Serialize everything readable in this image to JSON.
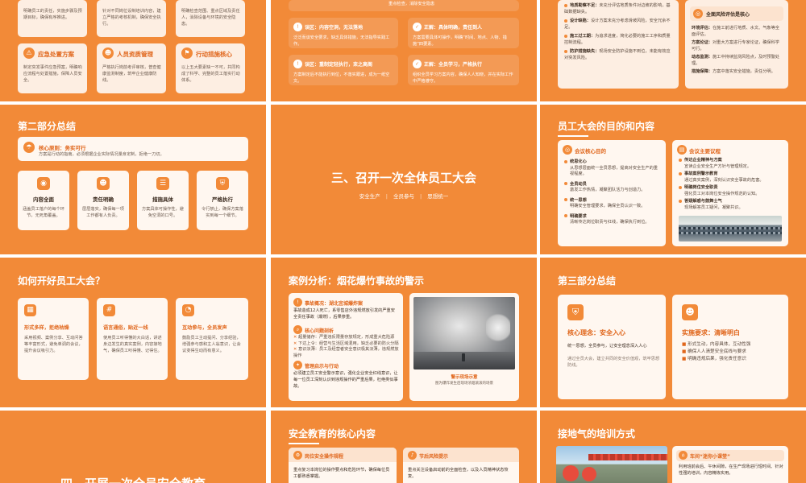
{
  "colors": {
    "accent": "#F28A38",
    "card": "#FDEEE2",
    "title": "#E0661B"
  },
  "r1": {
    "s1": {
      "c1_text": "明确员工的责任，实施步骤及预期目标，确保有序推进。",
      "c2_text": "针对不同岗位设制培训内容，建立严格的考核机制，确保安全执行。",
      "c3_text": "明确检查范围、重点区域及责任人，消除设备与环境的安全隐患。",
      "c4_title": "应急处置方案",
      "c4_text": "制定突发事件应急预案，明确响应流程与处置措施，保障人员安全。",
      "c5_title": "人员资质管理",
      "c5_text": "严格执行岗前考评审核，普查健康监测制度，筑牢企业健康防线。",
      "c6_title": "行动措施核心",
      "c6_text": "以上五大要素缺一不可，共同构成了科学、完整的员工落实行动体系。"
    },
    "s2": {
      "top_text": "重点检查，消除安全隐患",
      "i1_title": "误区：内容空洞，无法落地",
      "i1_text": "泛泛而谈安全要求，缺乏具体措施，无法指导实践工作。",
      "i2_title": "正解：具体明确，责任到人",
      "i2_text": "方案需要具体可操作，明确“时间、地点、人物、措施”四要素。",
      "i3_title": "误区：重制定轻执行，束之高阁",
      "i3_text": "方案制定后不能执行到位，不落实跟进，成为一纸空文。",
      "i4_title": "正解：全员学习，严格执行",
      "i4_text": "组织全员学习方案内容，确保人人知晓，并在实际工作中严格遵守。"
    },
    "s3": {
      "items": [
        {
          "t": "地质勘察不足：",
          "d": "未充分评估地质条件对边坡的影响，基础数据缺失。"
        },
        {
          "t": "设计缺陷：",
          "d": "设计方案未充分考虑滑坡风险，安全冗余不足。"
        },
        {
          "t": "施工过工期：",
          "d": "为追求进度，简化必要的施工工序和质量控制流程。"
        },
        {
          "t": "防护措施缺失：",
          "d": "现场安全防护设施不到位，未能有效应对突发风险。"
        }
      ],
      "r_title": "全面风险评估是核心",
      "r_items": [
        {
          "t": "环境评估：",
          "d": "在施工前进行地质、水文、气象等全面评估。"
        },
        {
          "t": "方案论证：",
          "d": "对重大方案进行专家论证，确保科学可行。"
        },
        {
          "t": "动态监测：",
          "d": "施工中持续监测风险点，及时预警处理。"
        },
        {
          "t": "措施保障：",
          "d": "方案中落实安全措施，责任分明。"
        }
      ]
    }
  },
  "r2": {
    "s1": {
      "title": "第二部分总结",
      "core_title": "核心原则：务实可行",
      "core_text": "方案是行动的指南，必须根据企业实际情况量身定制，拒绝一刀切。",
      "cards": [
        {
          "title": "内容全面",
          "text": "涵盖员工落户的每个环节，无死角覆盖。",
          "icon": "◉"
        },
        {
          "title": "责任明确",
          "text": "层层落实，确保每一项工作都有人负责。",
          "icon": "☻"
        },
        {
          "title": "措施具体",
          "text": "方案具体可操作性，避免空洞的口号。",
          "icon": "☰"
        },
        {
          "title": "严格执行",
          "text": "令行禁止，确保方案落实到每一个细节。",
          "icon": "⛨"
        }
      ]
    },
    "s2": {
      "title": "三、召开一次全体员工大会",
      "sub": [
        "安全生产",
        "全员参与",
        "思想统一"
      ]
    },
    "s3": {
      "title": "员工大会的目的和内容",
      "l_title": "会议核心目的",
      "l_items": [
        {
          "t": "统思化心",
          "d": "从思想层面统一全员思想，提高对安全生产的重视程度。"
        },
        {
          "t": "全员动员",
          "d": "激发工作热情，凝聚团队活力与创造力。"
        },
        {
          "t": "统一思想",
          "d": "明确安全管理要求，确保全员认识一致。"
        },
        {
          "t": "明确要求",
          "d": "清晰传达岗位职责与红线，确保执行到位。"
        }
      ],
      "r_title": "会议主要议程",
      "r_items": [
        {
          "t": "传达企业精神与方案",
          "d": "宣读企业安全生产方针与管理规定。"
        },
        {
          "t": "事故案例警示教育",
          "d": "通过真实案例，深刻认识安全事故的危害。"
        },
        {
          "t": "明确岗位安全职责",
          "d": "强化员工对本岗位安全操作规范的认知。"
        },
        {
          "t": "答疑解惑与鼓舞士气",
          "d": "现场解答员工疑问，凝聚共识。"
        }
      ],
      "img_label": "员工大会现场"
    }
  },
  "r3": {
    "s1": {
      "title": "如何开好员工大会？",
      "cards": [
        {
          "title": "形式多样，拒绝枯燥",
          "text": "采用视频、案例分享、互动问答等丰富形式，避免单调的会议，提升会议吸引力。",
          "icon": "▦"
        },
        {
          "title": "语言通俗，贴近一线",
          "text": "使用员工听得懂的大白话，讲述身边发生的真实案例，内容接地气，确保员工听得懂、记得住。",
          "icon": "#"
        },
        {
          "title": "互动参与，全员发声",
          "text": "鼓励员工主动提问、分享经验，增强参与感和主人翁意识，让会议变得生动而有意义。",
          "icon": "◔"
        }
      ]
    },
    "s2": {
      "title": "案例分析：烟花爆竹事故的警示",
      "b1_title": "事故概况：湖北宜城爆炸案",
      "b1_text": "事故造成12人死亡，系零售店外违规燃放引发的严重安全责任事故（爆燃），后果惨重。",
      "b2_title": "核心问题剖析",
      "b2_items": [
        "超量储存：严重违反限量存放规定，形成重大危险源",
        "下达上令：经营与生活区域混用，缺乏必要的防火分隔",
        "意识淡薄：员工及经营者安全意识极其淡薄，违规燃放操作"
      ],
      "b3_title": "管理启示与行动",
      "b3_text": "必须建立员工安全警示意识，强化企业安全红线意识，让每一位员工深刻认识到违规操作的严重后果，杜绝类似事故。",
      "img_title": "警示现场示意",
      "img_caption": "图为爆炸发生后现场浓烟滚滚的场景"
    },
    "s3": {
      "title": "第三部分总结",
      "l_title": "核心理念：安全入心",
      "l_text1": "统一思想，全员参与，让安全理念深入人心",
      "l_text2": "通过全员大会，建立共同的安全价值观，筑牢思想防线。",
      "r_title": "实施要求：清晰明白",
      "r_items": [
        "形式生动，内容具体，互动性强",
        "确保人人清楚安全底线与要求",
        "明确违规后果，强化责任意识"
      ]
    }
  },
  "r4": {
    "s1": {
      "title": "四、开展一次全员安全教育"
    },
    "s2": {
      "title": "安全教育的核心内容",
      "c1_title": "岗位安全操作规程",
      "c1_text": "重点复习本岗位的操作要点和危险环节，确保每位员工都熟悉掌握。",
      "c2_title": "节后风险提示",
      "c2_text": "重点关注设备启动前的全面检查，以及人员精神状态恢复。"
    },
    "s3": {
      "title": "接地气的培训方式",
      "card_title": "车间“迷你小课堂”",
      "card_text": "利用班前会后、午休间隙，在生产现场进行短时间、针对性强的培训，内容精炼实用。"
    }
  }
}
